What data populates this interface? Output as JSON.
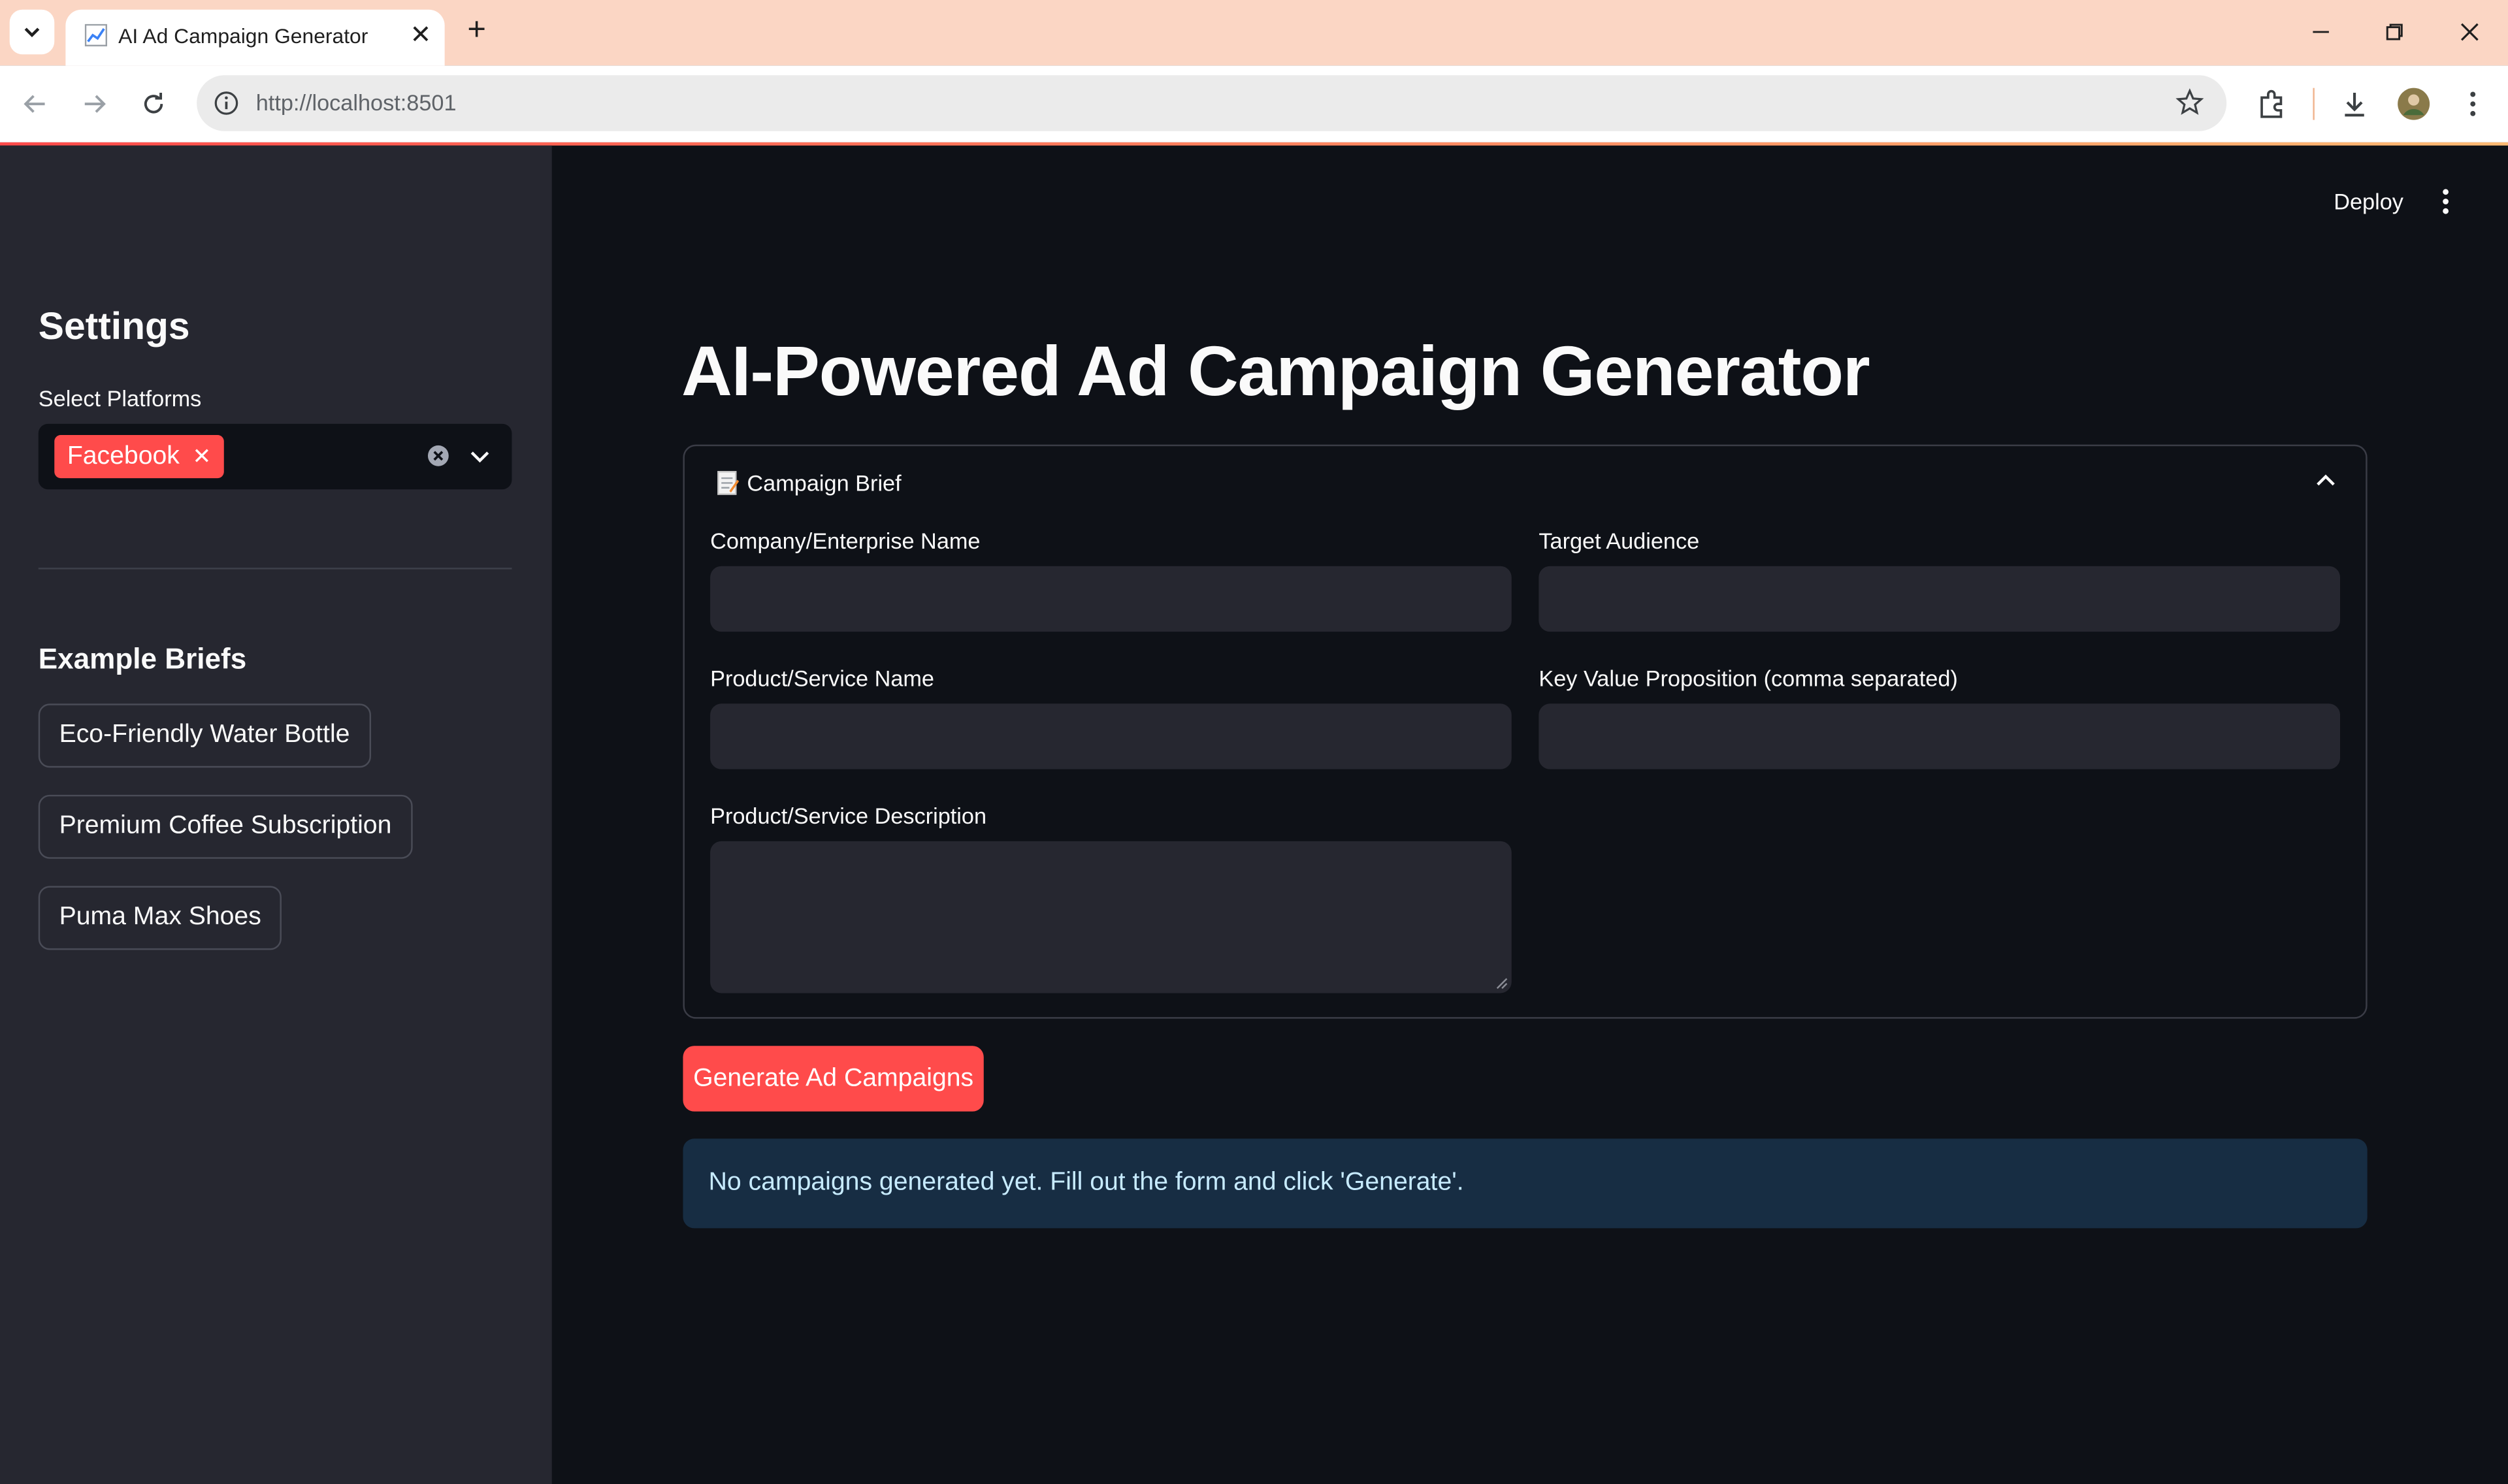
{
  "browser": {
    "tab_title": "AI Ad Campaign Generator",
    "url": "http://localhost:8501"
  },
  "sidebar": {
    "heading": "Settings",
    "platforms_label": "Select Platforms",
    "selected_platforms": [
      "Facebook"
    ],
    "examples_heading": "Example Briefs",
    "example_buttons": [
      "Eco-Friendly Water Bottle",
      "Premium Coffee Subscription",
      "Puma Max Shoes"
    ]
  },
  "header": {
    "deploy_label": "Deploy"
  },
  "main": {
    "title": "AI-Powered Ad Campaign Generator",
    "expander_title": "Campaign Brief",
    "fields": {
      "company_label": "Company/Enterprise Name",
      "company_value": "",
      "audience_label": "Target Audience",
      "audience_value": "",
      "product_label": "Product/Service Name",
      "product_value": "",
      "value_prop_label": "Key Value Proposition (comma separated)",
      "value_prop_value": "",
      "description_label": "Product/Service Description",
      "description_value": ""
    },
    "generate_button": "Generate Ad Campaigns",
    "info_message": "No campaigns generated yet. Fill out the form and click 'Generate'."
  },
  "colors": {
    "primary": "#ff4b4b",
    "background": "#0e1117",
    "sidebar": "#262730",
    "info_bg": "#172d43",
    "info_text": "#c7ebff"
  }
}
